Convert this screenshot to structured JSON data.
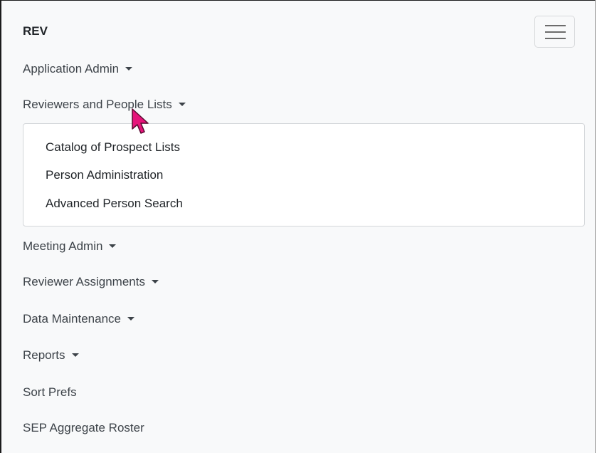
{
  "brand": "REV",
  "toggler_icon": "hamburger-menu-icon",
  "nav": {
    "application_admin": "Application Admin",
    "reviewers_people_lists": "Reviewers and People Lists",
    "meeting_admin": "Meeting Admin",
    "reviewer_assignments": "Reviewer Assignments",
    "data_maintenance": "Data Maintenance",
    "reports": "Reports",
    "sort_prefs": "Sort Prefs",
    "sep_aggregate_roster": "SEP Aggregate Roster"
  },
  "dropdown": {
    "items": [
      "Catalog of Prospect Lists",
      "Person Administration",
      "Advanced Person Search"
    ]
  },
  "colors": {
    "background": "#f8f9fa",
    "text": "#212529",
    "cursor": "#e6147a"
  }
}
